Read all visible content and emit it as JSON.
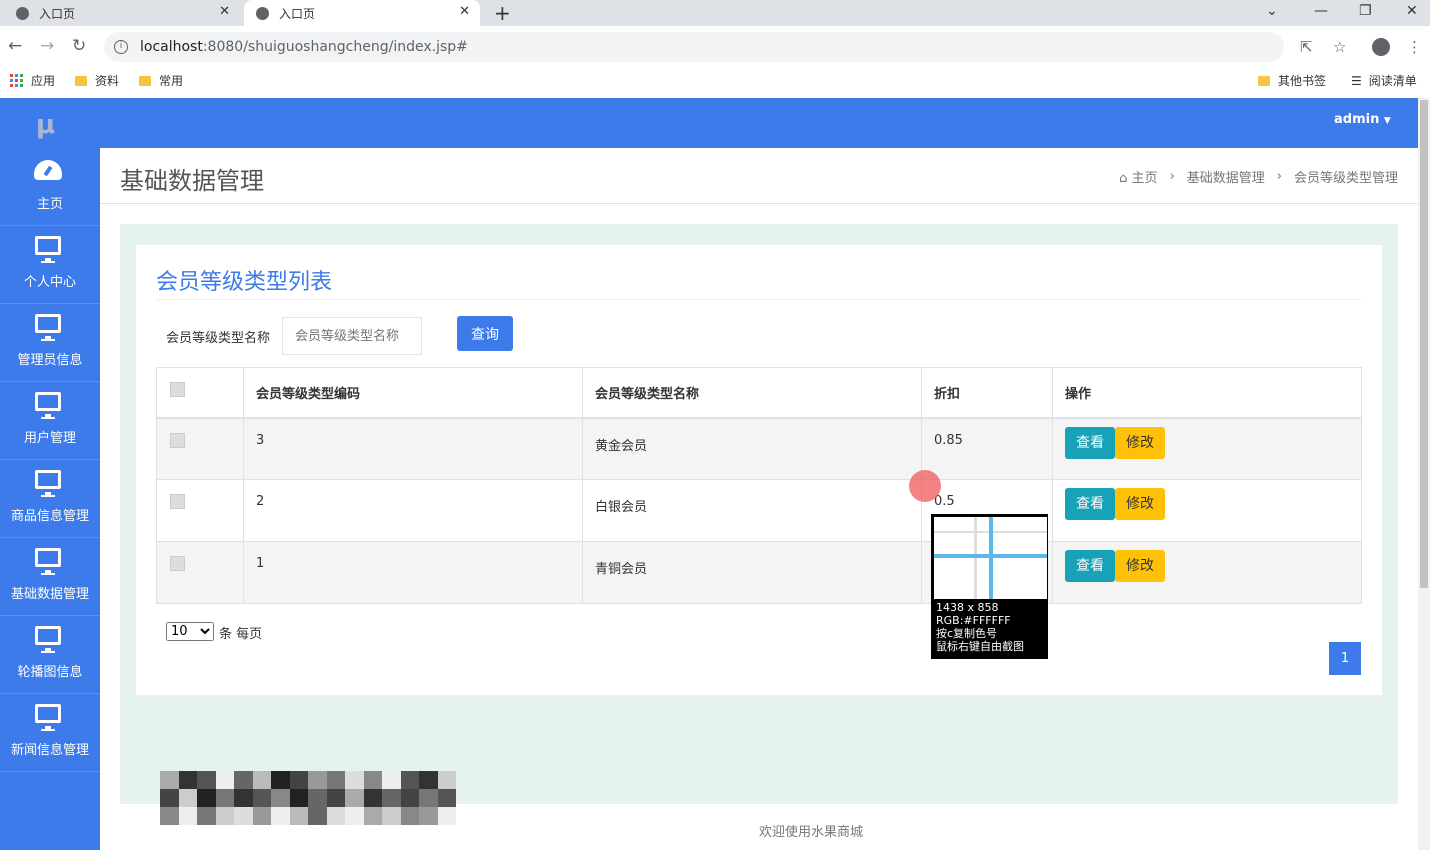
{
  "browser": {
    "tabs": [
      {
        "title": "入口页"
      },
      {
        "title": "入口页"
      }
    ],
    "url_host": "localhost",
    "url_rest": ":8080/shuiguoshangcheng/index.jsp#",
    "bookmarks": [
      "应用",
      "资料",
      "常用"
    ],
    "bookmarks_right": [
      "其他书签",
      "阅读清单"
    ]
  },
  "app": {
    "logo": "μ",
    "user": "admin",
    "sidebar": [
      {
        "label": "主页",
        "icon": "dashboard-icon"
      },
      {
        "label": "个人中心",
        "icon": "monitor-icon"
      },
      {
        "label": "管理员信息",
        "icon": "monitor-icon"
      },
      {
        "label": "用户管理",
        "icon": "monitor-icon"
      },
      {
        "label": "商品信息管理",
        "icon": "monitor-icon"
      },
      {
        "label": "基础数据管理",
        "icon": "monitor-icon"
      },
      {
        "label": "轮播图信息",
        "icon": "monitor-icon"
      },
      {
        "label": "新闻信息管理",
        "icon": "monitor-icon"
      }
    ]
  },
  "page": {
    "title": "基础数据管理",
    "breadcrumb": [
      "主页",
      "基础数据管理",
      "会员等级类型管理"
    ]
  },
  "card": {
    "title": "会员等级类型列表",
    "filter_label": "会员等级类型名称",
    "filter_placeholder": "会员等级类型名称",
    "query_button": "查询"
  },
  "table": {
    "columns": [
      "会员等级类型编码",
      "会员等级类型名称",
      "折扣",
      "操作"
    ],
    "rows": [
      {
        "code": "3",
        "name": "黄金会员",
        "discount": "0.85"
      },
      {
        "code": "2",
        "name": "白银会员",
        "discount": "0.5"
      },
      {
        "code": "1",
        "name": "青铜会员",
        "discount": ""
      }
    ],
    "view_label": "查看",
    "edit_label": "修改"
  },
  "pagination": {
    "page_size": "10",
    "page_size_suffix": "条 每页",
    "current_page": "1"
  },
  "footer": {
    "text": "欢迎使用水果商城"
  },
  "magnifier": {
    "size": "1438 x 858",
    "rgb": "RGB:#FFFFFF",
    "hint1": "按c复制色号",
    "hint2": "鼠标右键自由截图"
  },
  "colors": {
    "primary": "#3c7be9",
    "info": "#17a2b8",
    "warning": "#ffc107"
  }
}
